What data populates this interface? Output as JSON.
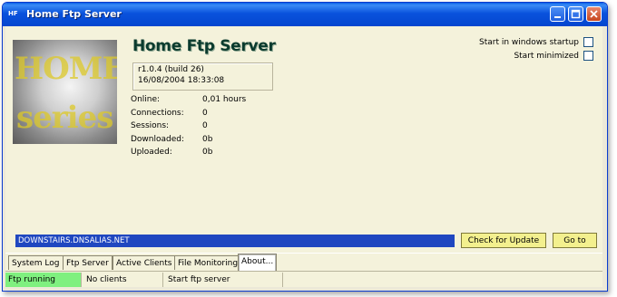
{
  "window": {
    "title": "Home Ftp Server",
    "app_icon": "HF",
    "controls": [
      "minimize-icon",
      "maximize-icon",
      "close-icon"
    ]
  },
  "logo": {
    "line1": "HOME",
    "line2": "series"
  },
  "header": {
    "app_title": "Home Ftp Server",
    "version": "r1.0.4 (build 26)",
    "build_date": "16/08/2004 18:33:08"
  },
  "stats": [
    {
      "label": "Online:",
      "value": "0,01 hours"
    },
    {
      "label": "Connections:",
      "value": "0"
    },
    {
      "label": "Sessions:",
      "value": "0"
    },
    {
      "label": "Downloaded:",
      "value": "0b"
    },
    {
      "label": "Uploaded:",
      "value": "0b"
    }
  ],
  "options": {
    "startup_label": "Start in windows startup",
    "startup_checked": false,
    "minimized_label": "Start minimized",
    "minimized_checked": false
  },
  "host": {
    "value": "DOWNSTAIRS.DNSALIAS.NET"
  },
  "buttons": {
    "check_update": "Check for Update",
    "go_to": "Go to"
  },
  "tabs": [
    "System Log",
    "Ftp Server",
    "Active Clients",
    "File Monitoring",
    "About..."
  ],
  "active_tab": "About...",
  "status": {
    "server": "Ftp running",
    "server_color": "#7ff07f",
    "clients": "No clients",
    "message": "Start ftp server"
  }
}
